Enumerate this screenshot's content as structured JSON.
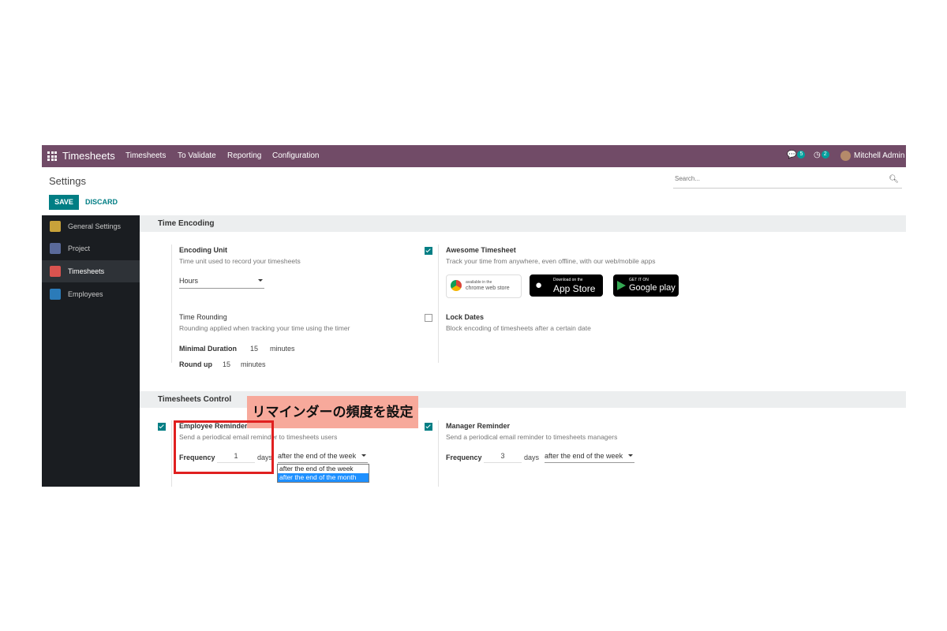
{
  "navbar": {
    "brand": "Timesheets",
    "menu": [
      "Timesheets",
      "To Validate",
      "Reporting",
      "Configuration"
    ],
    "messages_count": "5",
    "activities_count": "2",
    "user": "Mitchell Admin"
  },
  "page": {
    "title": "Settings",
    "save_label": "SAVE",
    "discard_label": "DISCARD",
    "search_placeholder": "Search..."
  },
  "sidebar": {
    "items": [
      {
        "label": "General Settings",
        "icon": "gear-icon",
        "color": "#c8a23a"
      },
      {
        "label": "Project",
        "icon": "puzzle-icon",
        "color": "#5a6a9a"
      },
      {
        "label": "Timesheets",
        "icon": "stopwatch-icon",
        "color": "#d9534f"
      },
      {
        "label": "Employees",
        "icon": "people-icon",
        "color": "#2b7bb9"
      }
    ]
  },
  "time_encoding": {
    "header": "Time Encoding",
    "encoding_unit": {
      "label": "Encoding Unit",
      "desc": "Time unit used to record your timesheets",
      "value": "Hours"
    },
    "awesome": {
      "label": "Awesome Timesheet",
      "desc": "Track your time from anywhere, even offline, with our web/mobile apps",
      "checked": true
    },
    "stores": {
      "chrome_small": "available in the",
      "chrome_big": "chrome web store",
      "apple_small": "Download on the",
      "apple_big": "App Store",
      "google_small": "GET IT ON",
      "google_big": "Google play"
    },
    "rounding": {
      "label": "Time Rounding",
      "desc": "Rounding applied when tracking your time using the timer",
      "min_label": "Minimal Duration",
      "min_value": "15",
      "min_unit": "minutes",
      "round_label": "Round up",
      "round_value": "15",
      "round_unit": "minutes"
    },
    "lock": {
      "label": "Lock Dates",
      "desc": "Block encoding of timesheets after a certain date",
      "checked": false
    }
  },
  "timesheets_control": {
    "header": "Timesheets Control",
    "employee": {
      "label": "Employee Reminder",
      "desc": "Send a periodical email reminder to timesheets users",
      "checked": true,
      "freq_label": "Frequency",
      "freq_value": "1",
      "freq_unit": "days",
      "period": "after the end of the week"
    },
    "manager": {
      "label": "Manager Reminder",
      "desc": "Send a periodical email reminder to timesheets managers",
      "checked": true,
      "freq_label": "Frequency",
      "freq_value": "3",
      "freq_unit": "days",
      "period": "after the end of the week"
    },
    "dropdown_options": [
      "after the end of the week",
      "after the end of the month"
    ]
  },
  "annotation": {
    "text": "リマインダーの頻度を設定"
  },
  "colors": {
    "brand": "#714b67",
    "accent": "#017e84",
    "highlight": "#e02020"
  }
}
